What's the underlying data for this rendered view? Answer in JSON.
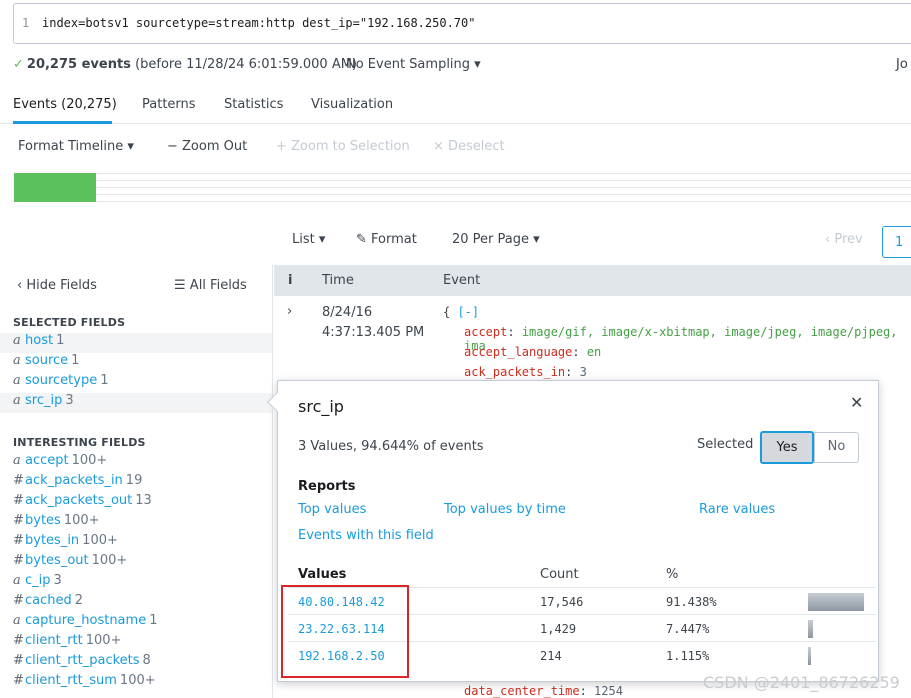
{
  "search": {
    "line_no": "1",
    "query": "index=botsv1 sourcetype=stream:http dest_ip=\"192.168.250.70\""
  },
  "status": {
    "check": "✓",
    "count": "20,275 events",
    "before": "(before 11/28/24 6:01:59.000 AM)",
    "sampling": "No Event Sampling ▾",
    "jobs": "Jo"
  },
  "tabs": [
    "Events (20,275)",
    "Patterns",
    "Statistics",
    "Visualization"
  ],
  "timeline_bar": {
    "format": "Format Timeline ▾",
    "zoom_out": "− Zoom Out",
    "zoom_sel": "+ Zoom to Selection",
    "deselect": "× Deselect"
  },
  "listbar": {
    "list": "List ▾",
    "format": "Format",
    "per_page": "20 Per Page ▾",
    "prev": "‹ Prev",
    "page": "1"
  },
  "fields": {
    "hide": "‹ Hide Fields",
    "all": "All Fields",
    "selected_header": "SELECTED FIELDS",
    "selected": [
      {
        "type": "a",
        "name": "host",
        "count": "1"
      },
      {
        "type": "a",
        "name": "source",
        "count": "1"
      },
      {
        "type": "a",
        "name": "sourcetype",
        "count": "1"
      },
      {
        "type": "a",
        "name": "src_ip",
        "count": "3"
      }
    ],
    "interesting_header": "INTERESTING FIELDS",
    "interesting": [
      {
        "type": "a",
        "name": "accept",
        "count": "100+"
      },
      {
        "type": "#",
        "name": "ack_packets_in",
        "count": "19"
      },
      {
        "type": "#",
        "name": "ack_packets_out",
        "count": "13"
      },
      {
        "type": "#",
        "name": "bytes",
        "count": "100+"
      },
      {
        "type": "#",
        "name": "bytes_in",
        "count": "100+"
      },
      {
        "type": "#",
        "name": "bytes_out",
        "count": "100+"
      },
      {
        "type": "a",
        "name": "c_ip",
        "count": "3"
      },
      {
        "type": "#",
        "name": "cached",
        "count": "2"
      },
      {
        "type": "a",
        "name": "capture_hostname",
        "count": "1"
      },
      {
        "type": "#",
        "name": "client_rtt",
        "count": "100+"
      },
      {
        "type": "#",
        "name": "client_rtt_packets",
        "count": "8"
      },
      {
        "type": "#",
        "name": "client_rtt_sum",
        "count": "100+"
      }
    ]
  },
  "events": {
    "col_i": "i",
    "col_time": "Time",
    "col_event": "Event",
    "expand": "›",
    "date": "8/24/16",
    "time": "4:37:13.405 PM",
    "json_open": "{ ",
    "json_collapse": "[-]",
    "lines": [
      {
        "key": "accept",
        "val": "image/gif, image/x-xbitmap, image/jpeg, image/pjpeg, ima",
        "kind": "str"
      },
      {
        "key": "accept_language",
        "val": "en",
        "kind": "str"
      },
      {
        "key": "ack_packets_in",
        "val": "3",
        "kind": "num"
      }
    ],
    "bottom_key": "data_center_time",
    "bottom_val": "1254"
  },
  "popup": {
    "title": "src_ip",
    "close": "✕",
    "summary": "3 Values, 94.644% of events",
    "selected_label": "Selected",
    "yes": "Yes",
    "no": "No",
    "reports": "Reports",
    "links": [
      "Top values",
      "Top values by time",
      "Rare values",
      "Events with this field"
    ],
    "col_values": "Values",
    "col_count": "Count",
    "col_pct": "%",
    "rows": [
      {
        "value": "40.80.148.42",
        "count": "17,546",
        "pct": "91.438%",
        "frac": 0.914
      },
      {
        "value": "23.22.63.114",
        "count": "1,429",
        "pct": "7.447%",
        "frac": 0.074
      },
      {
        "value": "192.168.2.50",
        "count": "214",
        "pct": "1.115%",
        "frac": 0.011
      }
    ]
  },
  "watermark": "CSDN @2401_86726259"
}
